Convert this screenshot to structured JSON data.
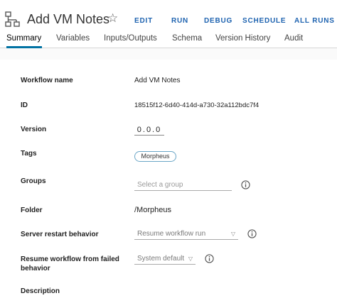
{
  "header": {
    "title": "Add VM Notes",
    "star_icon": "star-outline-icon",
    "actions": [
      "EDIT",
      "RUN",
      "DEBUG",
      "SCHEDULE",
      "ALL RUNS"
    ]
  },
  "tabs": [
    "Summary",
    "Variables",
    "Inputs/Outputs",
    "Schema",
    "Version History",
    "Audit"
  ],
  "active_tab": "Summary",
  "form": {
    "workflow_name": {
      "label": "Workflow name",
      "value": "Add VM Notes"
    },
    "id": {
      "label": "ID",
      "value": "18515f12-6d40-414d-a730-32a112bdc7f4"
    },
    "version": {
      "label": "Version",
      "value": "0.0.0"
    },
    "tags": {
      "label": "Tags",
      "values": [
        "Morpheus"
      ]
    },
    "groups": {
      "label": "Groups",
      "placeholder": "Select a group"
    },
    "folder": {
      "label": "Folder",
      "value": "/Morpheus"
    },
    "server_restart": {
      "label": "Server restart behavior",
      "value": "Resume workflow run"
    },
    "resume_failed": {
      "label_line1": "Resume workflow from failed",
      "label_line2": "behavior",
      "value": "System default"
    },
    "description": {
      "label": "Description"
    }
  },
  "colors": {
    "accent": "#1e63b0",
    "tab_underline": "#0072a3",
    "tag_border": "#6aa6c7"
  }
}
